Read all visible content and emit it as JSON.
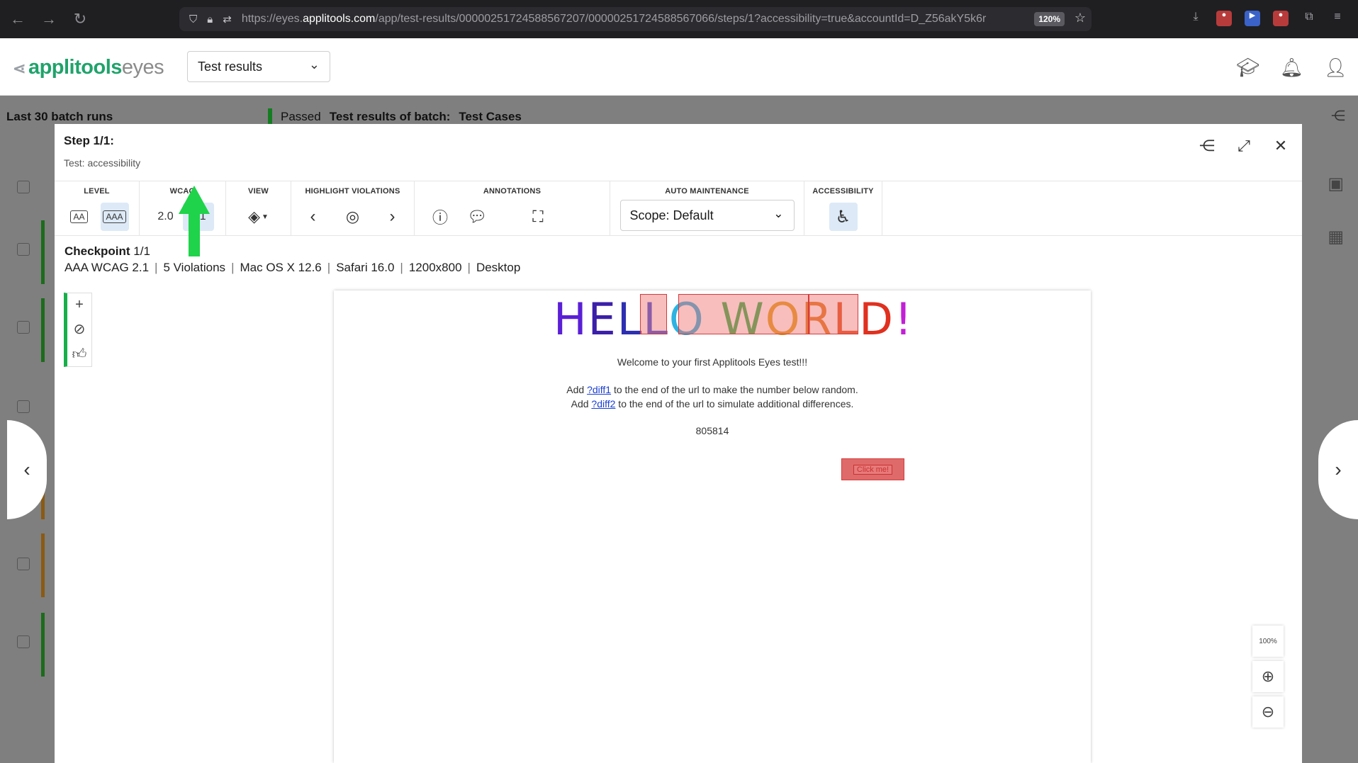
{
  "browser": {
    "url_prefix": "https://eyes.",
    "url_domain": "applitools.com",
    "url_path": "/app/test-results/00000251724588567207/00000251724588567066/steps/1?accessibility=true&accountId=D_Z56akY5k6r",
    "zoom": "120%"
  },
  "app": {
    "logo_main": "applitools",
    "logo_sub": "eyes",
    "page_selector": "Test results"
  },
  "background": {
    "title": "Last 30 batch runs",
    "batch_status": "Passed",
    "batch_label": "Test results of batch:",
    "batch_name": "Test Cases"
  },
  "modal": {
    "step_title": "Step 1/1:",
    "test_name": "Test: accessibility",
    "toolbar": {
      "level_label": "LEVEL",
      "level_aa": "AA",
      "level_aaa": "AAA",
      "wcag_label": "WCAG",
      "wcag_20": "2.0",
      "wcag_21": "2.1",
      "view_label": "VIEW",
      "highlight_label": "HIGHLIGHT VIOLATIONS",
      "annotations_label": "ANNOTATIONS",
      "auto_label": "AUTO MAINTENANCE",
      "scope": "Scope: Default",
      "accessibility_label": "ACCESSIBILITY"
    },
    "checkpoint": {
      "label": "Checkpoint",
      "count": "1/1",
      "standard": "AAA WCAG 2.1",
      "violations": "5 Violations",
      "os": "Mac OS X 12.6",
      "browser": "Safari 16.0",
      "viewport": "1200x800",
      "device": "Desktop"
    },
    "screenshot": {
      "hello": "HELLO WORLD!",
      "welcome": "Welcome to your first Applitools Eyes test!!!",
      "line1_pre": "Add ",
      "line1_link": "?diff1",
      "line1_post": " to the end of the url to make the number below random.",
      "line2_pre": "Add ",
      "line2_link": "?diff2",
      "line2_post": " to the end of the url to simulate additional differences.",
      "number": "805814",
      "button": "Click me!"
    },
    "zoom_fit": "100%"
  },
  "colors": {
    "brand": "#1fa36b",
    "passed": "#157c22",
    "violation": "#d63a3a",
    "arrow": "#1fd34a"
  }
}
